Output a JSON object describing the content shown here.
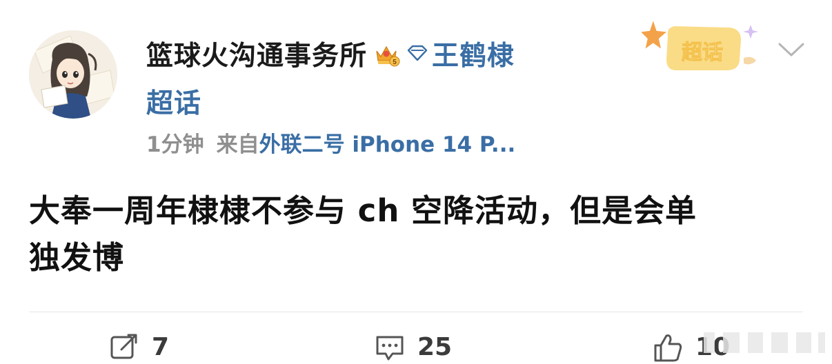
{
  "post": {
    "author": {
      "username": "篮球火沟通事务所",
      "crown_badge_icon": "crown-level5-icon",
      "diamond_badge_icon": "diamond-icon",
      "topic_name": "王鹤棣",
      "topic_suffix": "超话"
    },
    "meta": {
      "time": "1分钟",
      "from_label": "来自",
      "device": "外联二号 iPhone 14 P..."
    },
    "supertopic_tag": {
      "label": "超话",
      "icon": "star-icon"
    },
    "dropdown_icon": "chevron-down-icon",
    "text_line1": "大奉一周年棣棣不参与 ch 空降活动，但是会单",
    "text_line2": "独发博",
    "actions": {
      "repost": {
        "icon": "repost-icon",
        "count": "7"
      },
      "comment": {
        "icon": "comment-icon",
        "count": "25"
      },
      "like": {
        "icon": "thumbs-up-icon",
        "count": "10"
      }
    }
  },
  "colors": {
    "link_blue": "#3a6ea5",
    "meta_gray": "#8f8f8f",
    "text_dark": "#111111",
    "tag_yellow": "#f9d87a",
    "star_orange": "#f4a24a"
  }
}
